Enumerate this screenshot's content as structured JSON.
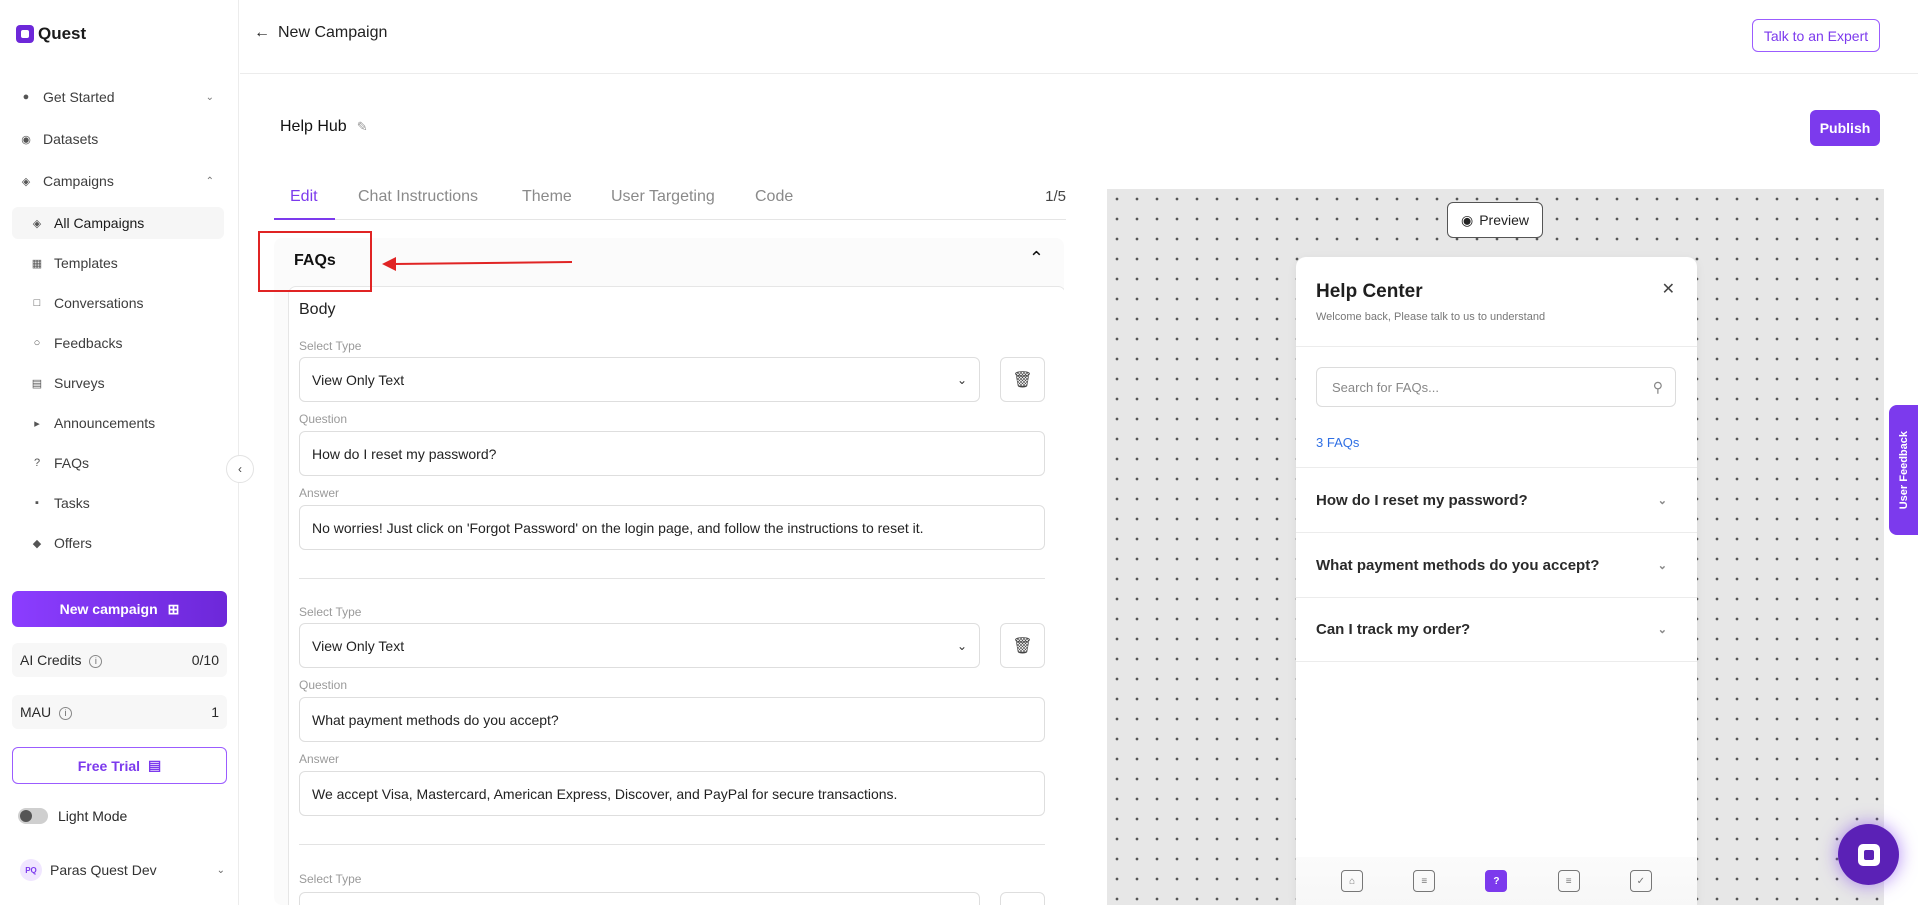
{
  "app": {
    "name": "Quest"
  },
  "sidebar": {
    "items": [
      {
        "label": "Get Started",
        "icon": "rocket-icon"
      },
      {
        "label": "Datasets",
        "icon": "database-icon"
      },
      {
        "label": "Campaigns",
        "icon": "layers-icon"
      },
      {
        "label": "All Campaigns",
        "icon": "layers-icon"
      },
      {
        "label": "Templates",
        "icon": "grid-icon"
      },
      {
        "label": "Conversations",
        "icon": "chat-icon"
      },
      {
        "label": "Feedbacks",
        "icon": "badge-icon"
      },
      {
        "label": "Surveys",
        "icon": "chart-icon"
      },
      {
        "label": "Announcements",
        "icon": "megaphone-icon"
      },
      {
        "label": "FAQs",
        "icon": "question-icon"
      },
      {
        "label": "Tasks",
        "icon": "clipboard-icon"
      },
      {
        "label": "Offers",
        "icon": "tag-icon"
      }
    ],
    "new_campaign_label": "New campaign",
    "ai_credits": {
      "label": "AI Credits",
      "value": "0/10"
    },
    "mau": {
      "label": "MAU",
      "value": "1"
    },
    "free_trial_label": "Free Trial",
    "mode_label": "Light Mode",
    "user": {
      "initials": "PQ",
      "name": "Paras Quest Dev"
    }
  },
  "header": {
    "back_label": "New Campaign",
    "expert_label": "Talk to an Expert",
    "page_title": "Help Hub",
    "publish_label": "Publish"
  },
  "tabs": {
    "items": [
      "Edit",
      "Chat Instructions",
      "Theme",
      "User Targeting",
      "Code"
    ],
    "page_count": "1/5"
  },
  "editor": {
    "section_title": "FAQs",
    "body_label": "Body",
    "select_type_label": "Select Type",
    "question_label": "Question",
    "answer_label": "Answer",
    "faqs": [
      {
        "type": "View Only Text",
        "question": "How do I reset my password?",
        "answer": "No worries! Just click on 'Forgot Password' on the login page, and follow the instructions to reset it."
      },
      {
        "type": "View Only Text",
        "question": "What payment methods do you accept?",
        "answer": "We accept Visa, Mastercard, American Express, Discover, and PayPal for secure transactions."
      }
    ]
  },
  "preview": {
    "button_label": "Preview",
    "title": "Help Center",
    "subtitle": "Welcome back, Please talk to us to understand",
    "search_placeholder": "Search for FAQs...",
    "count_label": "3 FAQs",
    "faqs": [
      "How do I reset my password?",
      "What payment methods do you accept?",
      "Can I track my order?"
    ]
  },
  "feedback_tab_label": "User Feedback",
  "colors": {
    "accent": "#7c3aed",
    "annotation": "#e02424",
    "link": "#2f6fe4"
  }
}
